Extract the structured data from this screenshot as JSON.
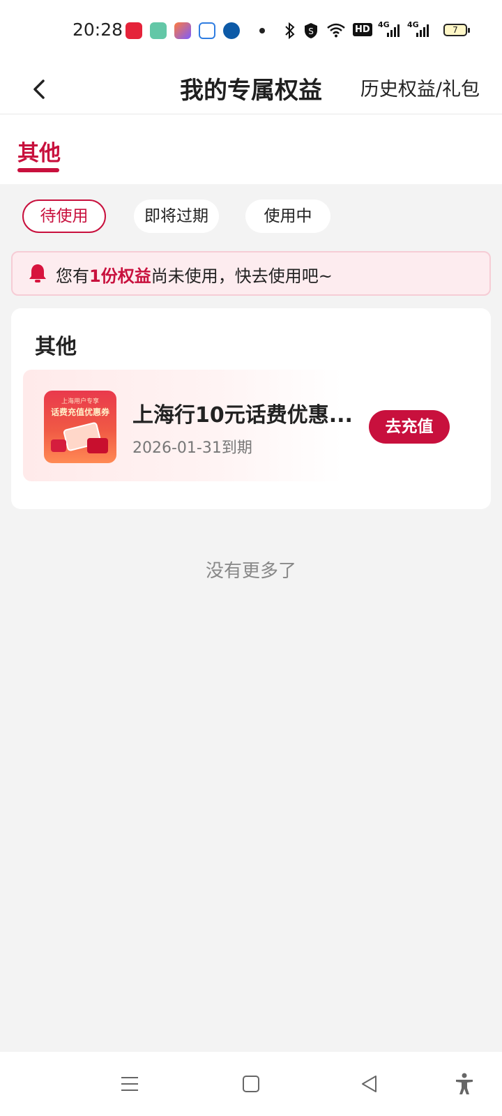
{
  "status_bar": {
    "time": "20:28",
    "app_icons": [
      "toutiao-app-icon",
      "gallery-app-icon",
      "store-app-icon",
      "cloud-app-icon",
      "bank-app-icon"
    ],
    "network_labels": [
      "HD",
      "4G",
      "4G"
    ],
    "battery": "7"
  },
  "header": {
    "title": "我的专属权益",
    "history_link": "历史权益/礼包"
  },
  "tabs": {
    "active": "其他"
  },
  "filters": [
    "待使用",
    "即将过期",
    "使用中"
  ],
  "notice": {
    "prefix": "您有",
    "highlight": "1份权益",
    "suffix": "尚未使用，快去使用吧~"
  },
  "section": {
    "title": "其他",
    "item": {
      "thumb_line1": "上海用户专享",
      "thumb_line2": "话费充值优惠券",
      "title": "上海行10元话费优惠...",
      "expiry": "2026-01-31到期",
      "button": "去充值"
    }
  },
  "end_text": "没有更多了",
  "colors": {
    "accent": "#c8103d",
    "notice_bg": "#fdecef",
    "page_bg": "#f3f3f3"
  }
}
